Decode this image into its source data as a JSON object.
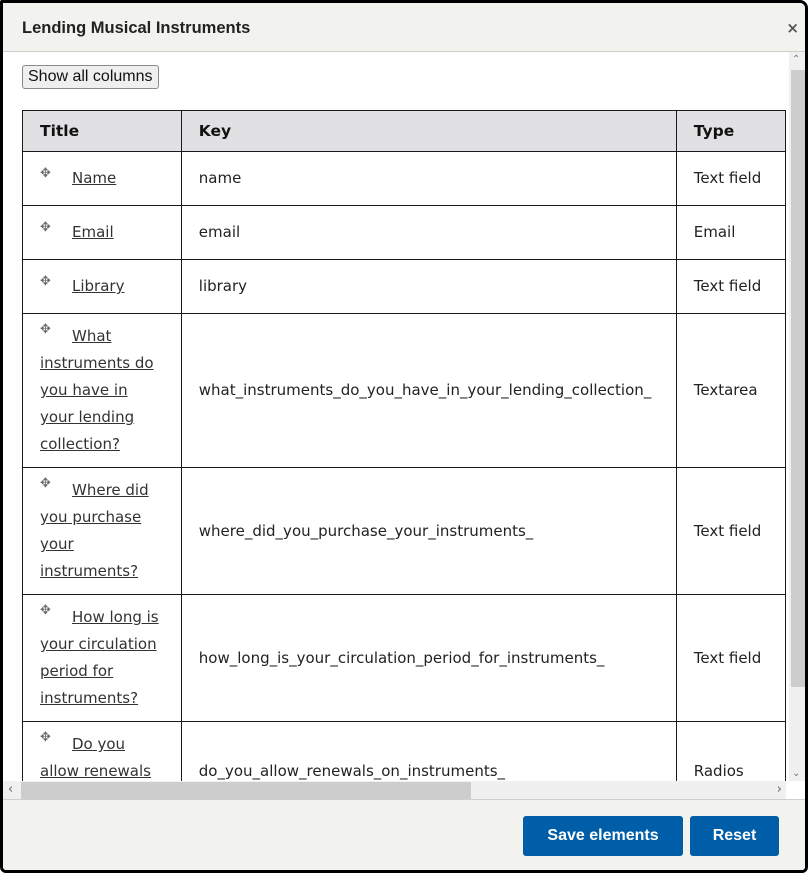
{
  "dialog": {
    "title": "Lending Musical Instruments",
    "close_icon": "×"
  },
  "toolbar": {
    "show_all_columns_label": "Show all columns"
  },
  "table": {
    "headers": [
      "Title",
      "Key",
      "Type"
    ],
    "rows": [
      {
        "title": "Name",
        "key": "name",
        "type": "Text field"
      },
      {
        "title": "Email",
        "key": "email",
        "type": "Email"
      },
      {
        "title": "Library",
        "key": "library",
        "type": "Text field"
      },
      {
        "title": "What instruments do you have in your lending collection?",
        "key": "what_instruments_do_you_have_in_your_lending_collection_",
        "type": "Textarea"
      },
      {
        "title": "Where did you purchase your instruments?",
        "key": "where_did_you_purchase_your_instruments_",
        "type": "Text field"
      },
      {
        "title": "How long is your circulation period for instruments?",
        "key": "how_long_is_your_circulation_period_for_instruments_",
        "type": "Text field"
      },
      {
        "title": "Do you allow renewals on instruments?",
        "key": "do_you_allow_renewals_on_instruments_",
        "type": "Radios"
      }
    ],
    "drag_icon": "✥"
  },
  "scrollbars": {
    "up_arrow": "⌃",
    "down_arrow": "⌄",
    "left_arrow": "‹",
    "right_arrow": "›"
  },
  "footer": {
    "save_label": "Save elements",
    "reset_label": "Reset"
  },
  "colors": {
    "primary_button": "#005ea8",
    "header_bg": "#f2f2ee",
    "table_header_bg": "#e1e1e3"
  }
}
